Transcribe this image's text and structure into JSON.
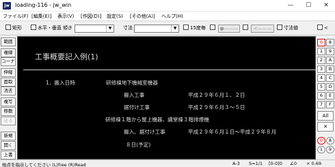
{
  "window": {
    "icon_label": "jw",
    "title": "loading-116 - jw_win",
    "minimize": "—",
    "maximize": "☐",
    "close": "✕"
  },
  "menu": [
    "ファイル(F)",
    "[編集(E)]",
    "表示(V)",
    "[作図(D)]",
    "設定(S)",
    "[その他(A)]",
    "ヘルプ(H)"
  ],
  "toolbar": {
    "rect_label": "矩形",
    "hv_label": "水平・垂直",
    "slope_label": "傾き",
    "dimension_label": "寸法",
    "deg15_label": "15度毎",
    "line_style_btn": "●———",
    "arrow_btn": "<———",
    "dim_value_label": "寸法値",
    "last_label": "<"
  },
  "left_panel": [
    {
      "label": "範囲",
      "disabled": false
    },
    {
      "label": "複線",
      "disabled": false
    },
    {
      "label": "コーナー",
      "disabled": false
    },
    {
      "label": "伸縮",
      "disabled": false
    },
    {
      "label": "面取",
      "disabled": false
    },
    {
      "label": "消去",
      "disabled": false
    },
    {
      "label": "複写",
      "disabled": false
    },
    {
      "label": "移動",
      "disabled": false
    },
    {
      "label": "戻る",
      "disabled": true
    },
    {
      "label": "新規",
      "disabled": false
    },
    {
      "label": "開く",
      "disabled": false
    },
    {
      "label": "上書",
      "disabled": false
    }
  ],
  "drawing": {
    "title": "工事概要記入例(1)",
    "lines": [
      "1．搬入日時",
      "研修棟地下機械室機器",
      "搬入工事",
      "平成２９年６月１、２日",
      "据付け工事",
      "平成２９年６月３～５日",
      "研修棟１階から屋上機器、講堂棟３階排煙機",
      "搬入、据付け工事",
      "平成２９年６月１日～平成２９年８月",
      "８日(予定)"
    ]
  },
  "right_panel": {
    "layer_groups": [
      "0",
      "8",
      "1",
      "9",
      "2",
      "A",
      "3",
      "B",
      "4",
      "C",
      "5",
      "D",
      "6",
      "E",
      "7",
      "F"
    ],
    "all_label": "All",
    "x_label": "✕",
    "bottom_buttons": [
      "0",
      "8",
      "1",
      "9"
    ]
  },
  "status": {
    "message": "始点を指示してください (L)free (R)Read",
    "paper": "A-3",
    "scale": "S=1/1",
    "layer": "[0-0]0",
    "angle": "∠0",
    "zoom": "× 0.69"
  }
}
